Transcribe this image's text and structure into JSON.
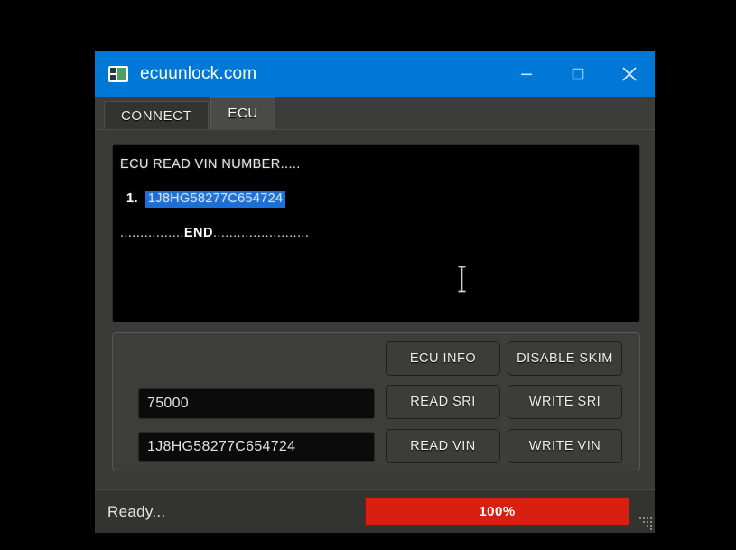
{
  "window": {
    "title": "ecuunlock.com",
    "app_icon": "app-window-icon",
    "controls": {
      "minimize": "minimize-icon",
      "maximize": "maximize-icon",
      "close": "close-icon"
    }
  },
  "tabs": [
    {
      "label": "CONNECT",
      "active": false
    },
    {
      "label": "ECU",
      "active": true
    }
  ],
  "console": {
    "header": "ECU READ VIN NUMBER.....",
    "entry_index": "1.",
    "entry_value": "1J8HG58277C654724",
    "end_line_prefix": "................",
    "end_line_word": "END",
    "end_line_suffix": "........................",
    "cursor": "text-cursor-ibeam"
  },
  "fields": {
    "sri_value": "75000",
    "vin_value": "1J8HG58277C654724"
  },
  "buttons": {
    "ecu_info": "ECU INFO",
    "disable_skim": "DISABLE SKIM",
    "read_sri": "READ SRI",
    "write_sri": "WRITE SRI",
    "read_vin": "READ VIN",
    "write_vin": "WRITE VIN"
  },
  "statusbar": {
    "status": "Ready...",
    "progress_label": "100%",
    "progress_percent": 100
  },
  "colors": {
    "titlebar_blue": "#0078d7",
    "window_gray": "#3a3a38",
    "console_black": "#000000",
    "selection_blue": "#1b6fd6",
    "progress_red": "#d81f10",
    "desktop_black": "#000000"
  }
}
